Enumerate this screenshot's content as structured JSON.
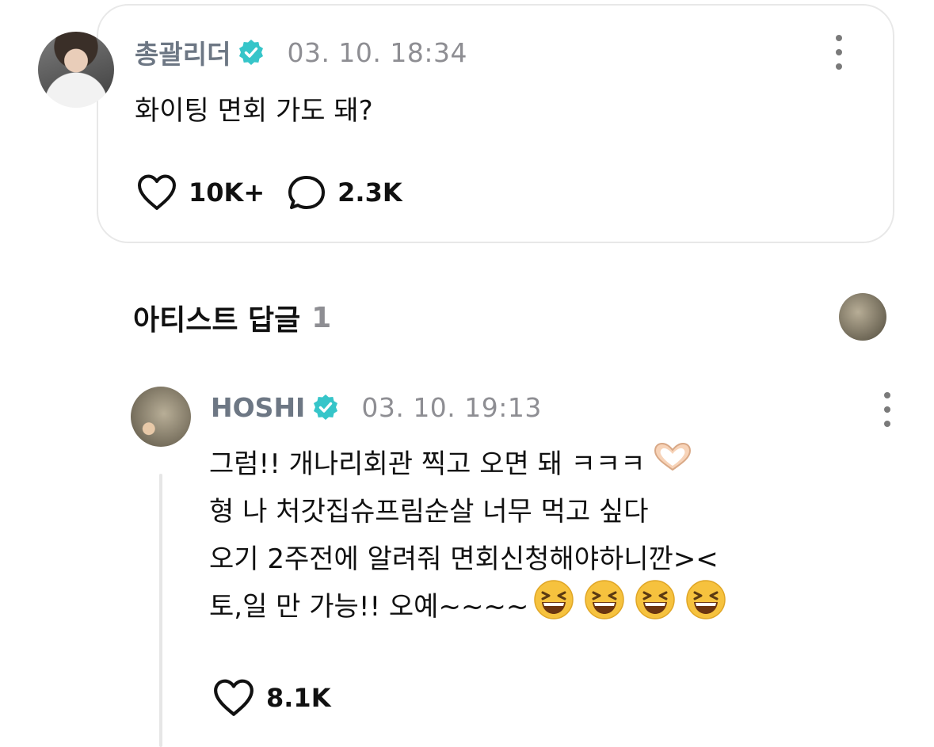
{
  "post": {
    "author": "총괄리더",
    "timestamp": "03. 10. 18:34",
    "text": "화이팅 면회 가도 돼?",
    "likes": "10K+",
    "comments": "2.3K"
  },
  "artist_replies": {
    "title": "아티스트 답글",
    "count": "1"
  },
  "reply": {
    "author": "HOSHI",
    "timestamp": "03. 10. 19:13",
    "lines": [
      "그럼!! 개나리회관 찍고 오면 돼 ㅋㅋㅋ",
      "형 나 처갓집슈프림순살 너무 먹고 싶다",
      "오기 2주전에 알려줘 면회신청해야하니깐><",
      "토,일 만 가능!! 오예~~~~"
    ],
    "likes": "8.1K"
  },
  "colors": {
    "verified": "#36c5c9",
    "name_gray": "#6d7784",
    "time_gray": "#8e8e93"
  },
  "icons": [
    "verified-badge-icon",
    "more-vertical-icon",
    "heart-icon",
    "comment-bubble-icon",
    "heart-hands-emoji",
    "grinning-squinting-emoji"
  ]
}
